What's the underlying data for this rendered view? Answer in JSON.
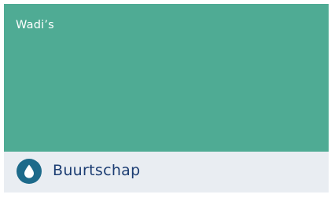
{
  "card": {
    "title": "Wadi’s",
    "image_color": "#4fab94",
    "category": {
      "label": "Buurtschap",
      "icon": "water-drop-icon",
      "badge_color": "#1d6a8a"
    }
  }
}
